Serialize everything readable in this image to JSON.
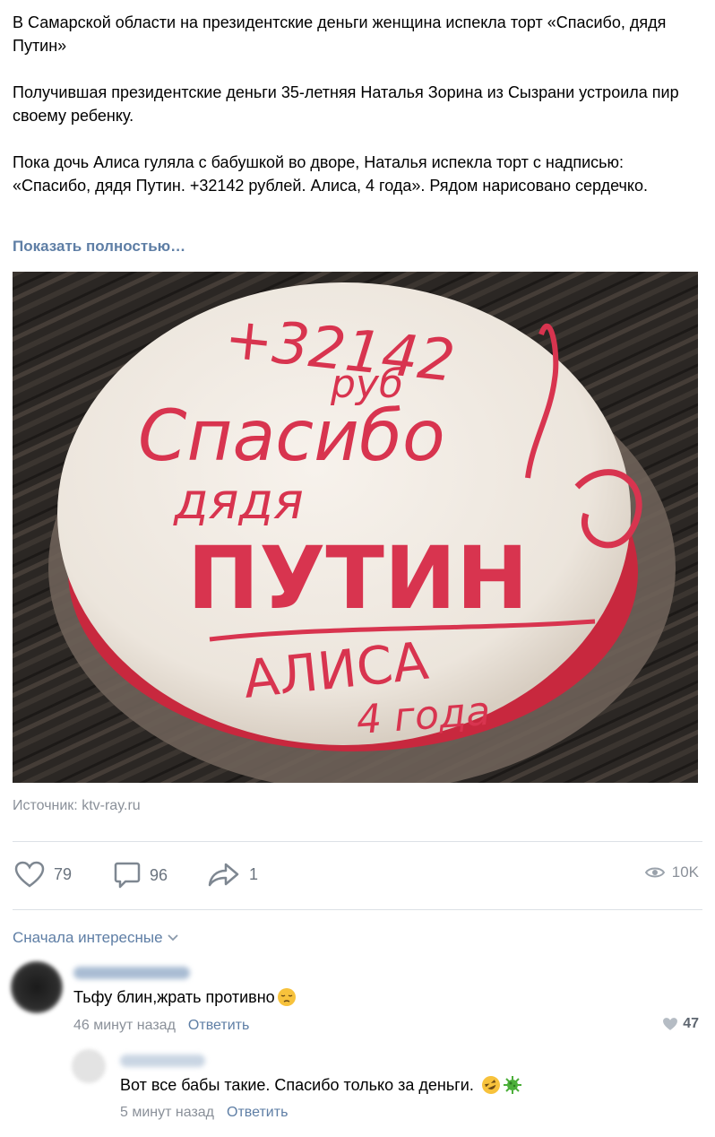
{
  "post": {
    "paragraphs": [
      "В Самарской области на президентские деньги женщина испекла торт «Спасибо, дядя Путин»",
      "Получившая президентские деньги 35-летняя Наталья Зорина из Сызрани устроила пир своему ребенку.",
      "Пока дочь Алиса гуляла с бабушкой во дворе, Наталья испекла торт с надписью: «Спасибо, дядя Путин. +32142 рублей. Алиса, 4 года». Рядом нарисовано сердечко."
    ],
    "show_more": "Показать полностью…",
    "photo": {
      "line1": "+32142",
      "line2": "руб",
      "line3": "Спасибо",
      "line4": "дядя",
      "line5": "ПУТИН",
      "line6": "АЛИСА",
      "line7": "4 года"
    },
    "source": "Источник: ktv-ray.ru"
  },
  "actions": {
    "likes": "79",
    "comments": "96",
    "shares": "1",
    "views": "10K"
  },
  "comments_section": {
    "sort_label": "Сначала интересные",
    "items": [
      {
        "text": "Тьфу блин,жрать противно",
        "time": "46 минут назад",
        "reply": "Ответить",
        "likes": "47"
      },
      {
        "text": "Вот все бабы такие. Спасибо только за деньги.",
        "time": "5 минут назад",
        "reply": "Ответить"
      }
    ]
  },
  "colors": {
    "link": "#5e7ea5",
    "muted": "#8a9099",
    "icing": "#d8344f"
  }
}
